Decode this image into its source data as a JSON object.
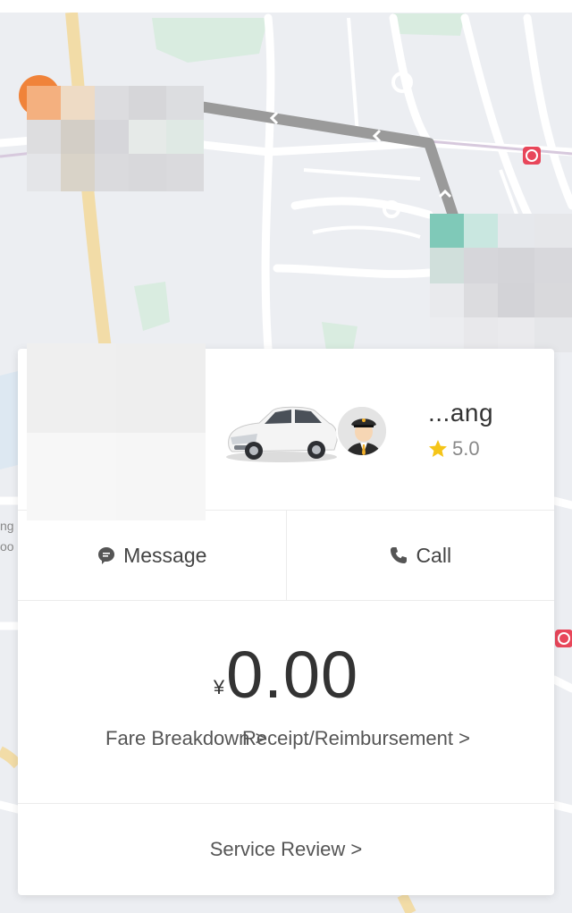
{
  "driver": {
    "name": "...ang",
    "rating": "5.0"
  },
  "actions": {
    "message_label": "Message",
    "call_label": "Call"
  },
  "fare": {
    "currency": "¥",
    "amount": "0.00",
    "breakdown_label": "Fare Breakdown >",
    "receipt_label": "Receipt/Reimbursement >"
  },
  "review": {
    "label": "Service Review >"
  },
  "colors": {
    "route": "#9a9a9a",
    "start_marker": "#f0833a",
    "end_marker": "#7fc9b8",
    "star": "#f5c518",
    "card_bg": "#ffffff"
  },
  "icons": [
    "message-icon",
    "phone-icon",
    "star-icon",
    "route-arrow-icon",
    "metro-station-icon"
  ]
}
